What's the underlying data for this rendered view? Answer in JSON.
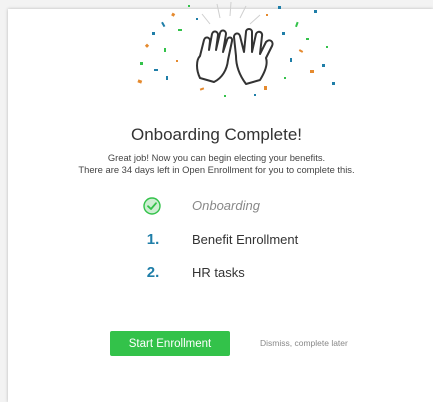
{
  "header": {
    "title": "Onboarding Complete!",
    "subtitle_line1": "Great job! Now you can begin electing your benefits.",
    "subtitle_line2": "There are 34 days left in Open Enrollment for you to complete this."
  },
  "steps": [
    {
      "marker": "",
      "label": "Onboarding",
      "status": "complete",
      "icon": "check-circle-icon"
    },
    {
      "marker": "1.",
      "label": "Benefit Enrollment",
      "status": "pending"
    },
    {
      "marker": "2.",
      "label": "HR tasks",
      "status": "pending"
    }
  ],
  "actions": {
    "primary_label": "Start Enrollment",
    "secondary_label": "Dismiss, complete later"
  },
  "illustration": {
    "icon": "high-five-hands-icon",
    "confetti_colors": [
      "#e58a2e",
      "#1f7ea8",
      "#33c24a",
      "#f0b400"
    ]
  },
  "colors": {
    "accent": "#33c24a",
    "step_number": "#1f7ea8"
  }
}
